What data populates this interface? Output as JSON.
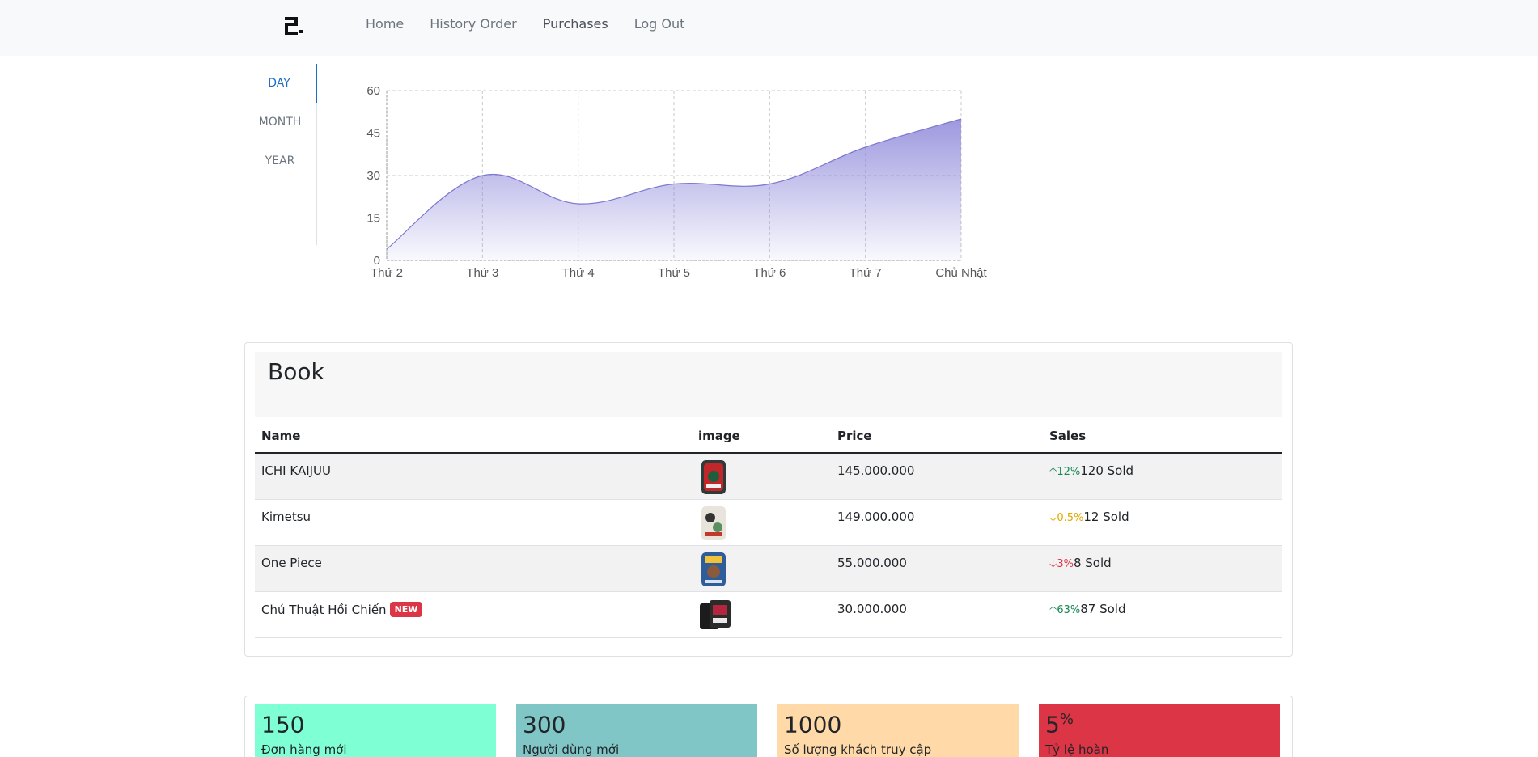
{
  "nav": {
    "links": [
      "Home",
      "History Order",
      "Purchases",
      "Log Out"
    ]
  },
  "period_tabs": [
    "DAY",
    "MONTH",
    "YEAR"
  ],
  "chart_data": {
    "type": "area",
    "categories": [
      "Thứ 2",
      "Thứ 3",
      "Thứ 4",
      "Thứ 5",
      "Thứ 6",
      "Thứ 7",
      "Chủ Nhật"
    ],
    "values": [
      4,
      30,
      20,
      27,
      27,
      40,
      50
    ],
    "yticks": [
      "0",
      "15",
      "30",
      "45",
      "60"
    ],
    "ylim": [
      0,
      60
    ],
    "grid": true,
    "color": "#8b86d9"
  },
  "book": {
    "title": "Book",
    "columns": [
      "Name",
      "image",
      "Price",
      "Sales"
    ],
    "rows": [
      {
        "name": "ICHI KAIJUU",
        "badge": "",
        "price": "145.000.000",
        "trend": "12%",
        "dir": "up",
        "sold": "120 Sold"
      },
      {
        "name": "Kimetsu",
        "badge": "",
        "price": "149.000.000",
        "trend": "0.5%",
        "dir": "flat",
        "sold": "12 Sold"
      },
      {
        "name": "One Piece",
        "badge": "",
        "price": "55.000.000",
        "trend": "3%",
        "dir": "down",
        "sold": "8 Sold"
      },
      {
        "name": "Chú Thuật Hồi Chiến",
        "badge": "NEW",
        "price": "30.000.000",
        "trend": "63%",
        "dir": "up",
        "sold": "87 Sold"
      }
    ]
  },
  "stats": [
    {
      "value": "150",
      "sup": "",
      "label": "Đơn hàng mới",
      "color": "#7fffd4"
    },
    {
      "value": "300",
      "sup": "",
      "label": "Người dùng mới",
      "color": "#80c6c6"
    },
    {
      "value": "1000",
      "sup": "",
      "label": "Số lượng khách truy cập",
      "color": "#ffdaa8"
    },
    {
      "value": "5",
      "sup": "%",
      "label": "Tỷ lệ hoàn",
      "color": "#dc3545"
    }
  ]
}
